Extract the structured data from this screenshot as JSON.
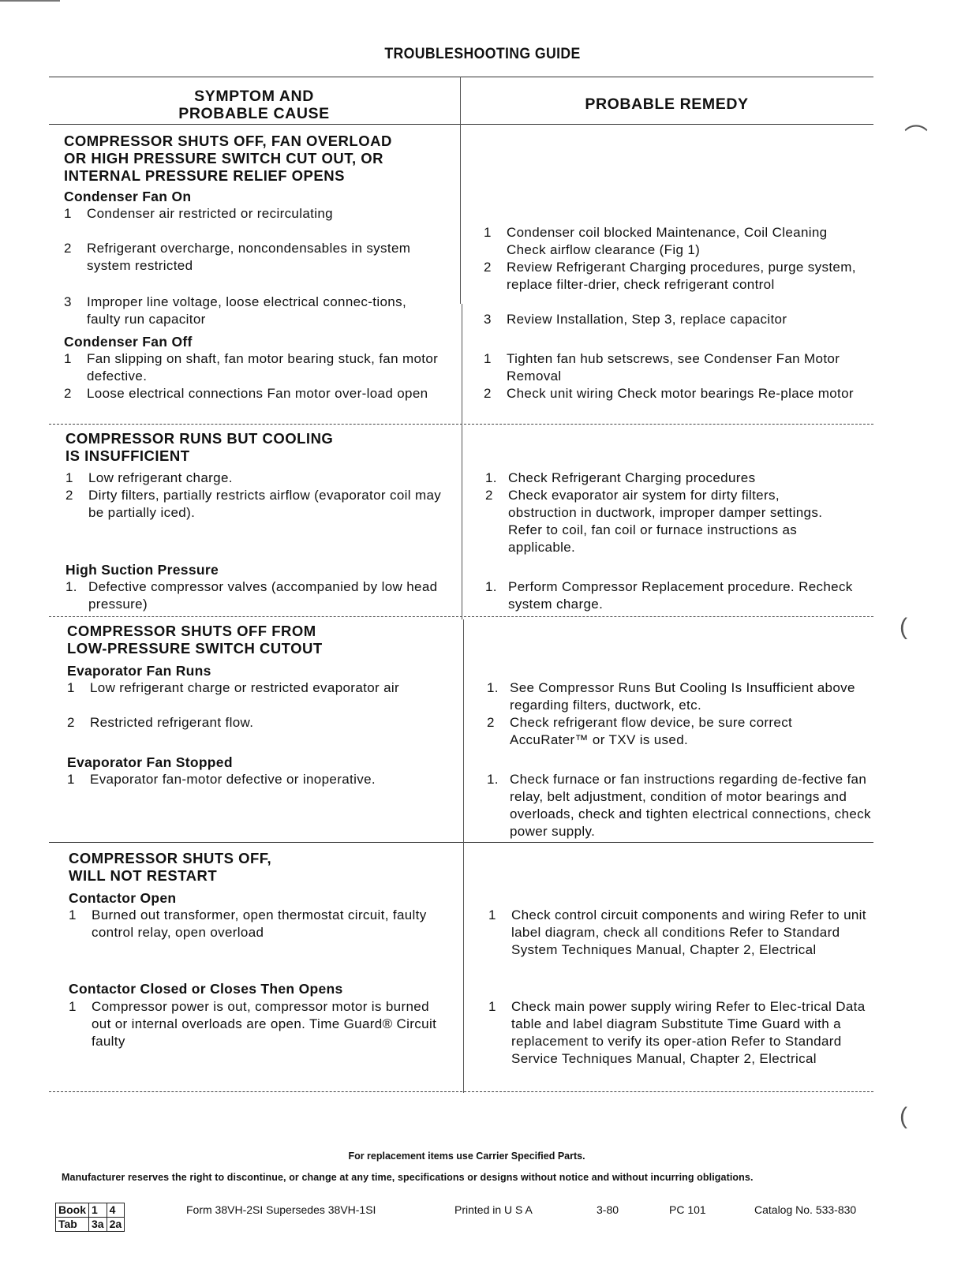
{
  "document": {
    "title": "TROUBLESHOOTING GUIDE",
    "columns": {
      "cause": [
        "SYMPTOM AND",
        "PROBABLE CAUSE"
      ],
      "remedy": "PROBABLE REMEDY"
    },
    "sections": [
      {
        "title": [
          "COMPRESSOR SHUTS OFF, FAN OVERLOAD",
          "OR HIGH PRESSURE SWITCH CUT OUT, OR",
          "INTERNAL PRESSURE RELIEF OPENS"
        ],
        "groups": [
          {
            "subtitle": "Condenser Fan On",
            "causes": [
              {
                "num": "1",
                "text": "Condenser air restricted or recirculating"
              },
              {
                "num": "2",
                "text": "Refrigerant overcharge, noncondensables in system  system restricted"
              },
              {
                "num": "3",
                "text": "Improper line voltage, loose electrical connec-tions, faulty run capacitor"
              }
            ],
            "remedies": [
              {
                "num": "1",
                "text": "Condenser coil blocked  Maintenance, Coil Cleaning  Check airflow clearance (Fig  1)"
              },
              {
                "num": "2",
                "text": "Review Refrigerant Charging procedures, purge system, replace filter-drier, check refrigerant control"
              },
              {
                "num": "3",
                "text": "Review Installation, Step 3, replace capacitor"
              }
            ]
          },
          {
            "subtitle": "Condenser Fan Off",
            "causes": [
              {
                "num": "1",
                "text": "Fan slipping on shaft, fan motor bearing stuck, fan motor defective."
              },
              {
                "num": "2",
                "text": "Loose electrical connections  Fan motor over-load open"
              }
            ],
            "remedies": [
              {
                "num": "1",
                "text": "Tighten fan hub setscrews, see Condenser Fan Motor Removal"
              },
              {
                "num": "2",
                "text": "Check unit wiring  Check motor bearings  Re-place motor"
              }
            ]
          }
        ]
      },
      {
        "title": [
          "COMPRESSOR RUNS BUT COOLING",
          "IS INSUFFICIENT"
        ],
        "groups": [
          {
            "subtitle": "",
            "causes": [
              {
                "num": "1",
                "text": "Low refrigerant charge."
              },
              {
                "num": "2",
                "text": "Dirty filters, partially restricts airflow (evaporator coil may be partially iced)."
              }
            ],
            "remedies": [
              {
                "num": "1.",
                "text": "Check Refrigerant Charging procedures"
              },
              {
                "num": "2",
                "text": "Check evaporator air system for dirty filters, obstruction in ductwork, improper damper settings. Refer to coil, fan coil or furnace instructions as applicable."
              }
            ]
          },
          {
            "subtitle": "High Suction Pressure",
            "causes": [
              {
                "num": "1.",
                "text": "Defective compressor valves (accompanied by low head pressure)"
              }
            ],
            "remedies": [
              {
                "num": "1.",
                "text": "Perform Compressor Replacement procedure. Recheck system charge."
              }
            ]
          }
        ]
      },
      {
        "title": [
          "COMPRESSOR SHUTS OFF FROM",
          "LOW-PRESSURE SWITCH CUTOUT"
        ],
        "groups": [
          {
            "subtitle": "Evaporator Fan Runs",
            "causes": [
              {
                "num": "1",
                "text": "Low refrigerant charge or restricted evaporator air"
              },
              {
                "num": "2",
                "text": "Restricted refrigerant flow."
              }
            ],
            "remedies": [
              {
                "num": "1.",
                "text": "See Compressor Runs But Cooling Is Insufficient above regarding filters, ductwork, etc."
              },
              {
                "num": "2",
                "text": "Check refrigerant flow device, be sure correct AccuRater™ or TXV is used."
              }
            ]
          },
          {
            "subtitle": "Evaporator Fan Stopped",
            "causes": [
              {
                "num": "1",
                "text": "Evaporator fan-motor defective or inoperative."
              }
            ],
            "remedies": [
              {
                "num": "1.",
                "text": "Check furnace or fan instructions regarding de-fective fan relay, belt adjustment, condition of motor bearings and overloads, check and tighten electrical connections, check power supply."
              }
            ]
          }
        ]
      },
      {
        "title": [
          "COMPRESSOR SHUTS OFF,",
          "WILL NOT RESTART"
        ],
        "groups": [
          {
            "subtitle": "Contactor Open",
            "causes": [
              {
                "num": "1",
                "text": "Burned out transformer, open thermostat circuit, faulty control relay, open overload"
              }
            ],
            "remedies": [
              {
                "num": "1",
                "text": "Check control circuit components and wiring Refer to unit label diagram, check all conditions Refer to Standard System Techniques Manual, Chapter 2, Electrical"
              }
            ]
          },
          {
            "subtitle": "Contactor Closed or Closes Then Opens",
            "causes": [
              {
                "num": "1",
                "text": "Compressor power is out, compressor motor is burned out or internal overloads are open. Time Guard® Circuit faulty"
              }
            ],
            "remedies": [
              {
                "num": "1",
                "text": "Check main power supply wiring  Refer to Elec-trical Data table and label diagram  Substitute Time Guard with a replacement to verify its oper-ation  Refer to Standard Service Techniques Manual, Chapter 2, Electrical"
              }
            ]
          }
        ]
      }
    ]
  },
  "footer": {
    "parts_note": "For replacement items use Carrier Specified Parts.",
    "disclaimer": "Manufacturer reserves the right to discontinue, or change at any time, specifications or designs without notice and without incurring obligations.",
    "book_tab": {
      "book_label": "Book",
      "book_1": "1",
      "book_2": "4",
      "tab_label": "Tab",
      "tab_1": "3a",
      "tab_2": "2a"
    },
    "form": "Form 38VH-2SI  Supersedes 38VH-1SI",
    "printed": "Printed in U S A",
    "date": "3-80",
    "pc": "PC 101",
    "catalog": "Catalog No. 533-830"
  }
}
